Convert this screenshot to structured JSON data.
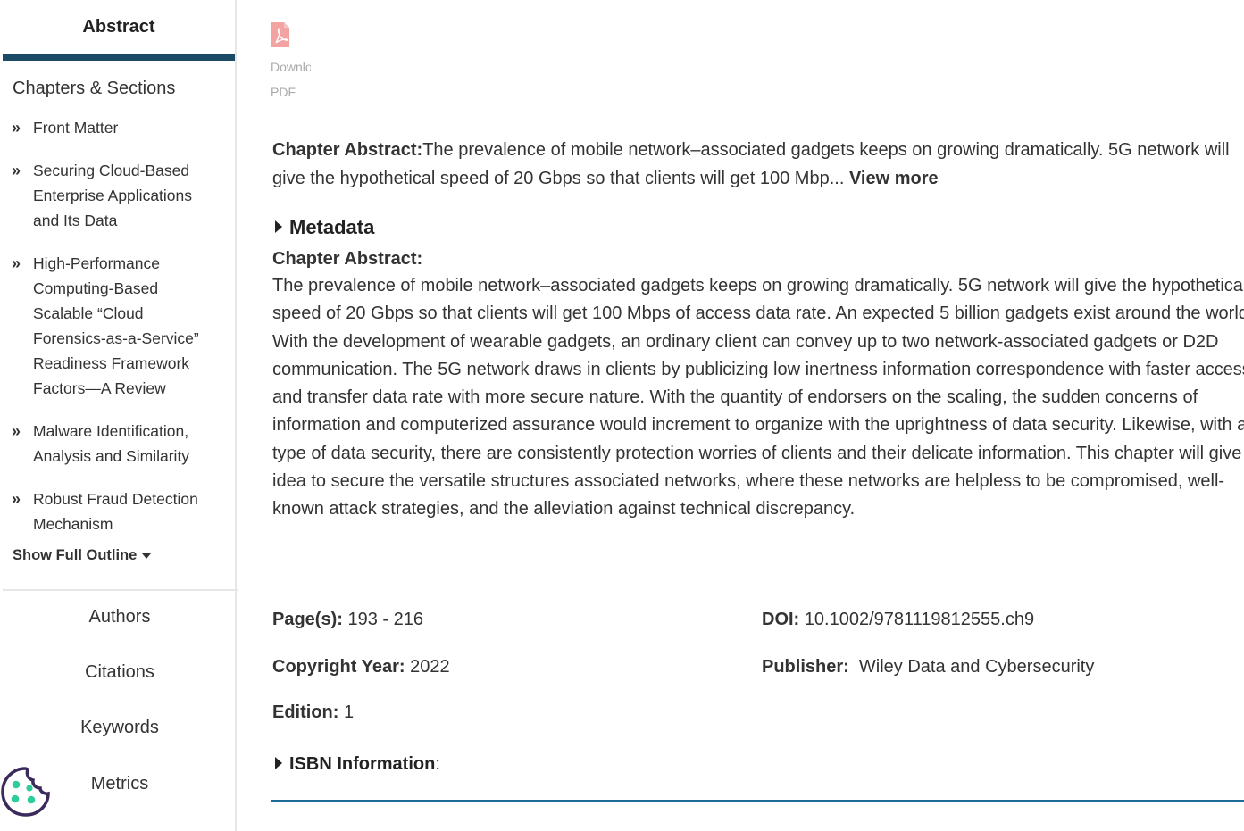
{
  "sidebar": {
    "abstract_tab": "Abstract",
    "toc_heading": "Chapters & Sections",
    "toc_items": [
      {
        "label": "Front Matter"
      },
      {
        "label": "Securing Cloud-Based Enterprise Applications and Its Data"
      },
      {
        "label": "High-Performance Computing-Based Scalable “Cloud Forensics-as-a-Service” Readiness Framework Factors—A Review"
      },
      {
        "label": "Malware Identification, Analysis and Similarity"
      },
      {
        "label": "Robust Fraud Detection Mechanism"
      }
    ],
    "show_outline": "Show Full Outline",
    "links": {
      "authors": "Authors",
      "citations": "Citations",
      "keywords": "Keywords",
      "metrics": "Metrics"
    }
  },
  "pdf": {
    "download_label": "Download",
    "pdf_label": "PDF"
  },
  "abstract": {
    "short_label": "Chapter Abstract:",
    "short_text": "The prevalence of mobile network–associated gadgets keeps on growing dramatically. 5G network will give the hypothetical speed of 20 Gbps so that clients will get 100 Mbp...",
    "view_more": "View more",
    "metadata_label": "Metadata",
    "full_label": "Chapter Abstract:",
    "full_text": "The prevalence of mobile network–associated gadgets keeps on growing dramatically. 5G network will give the hypothetical speed of 20 Gbps so that clients will get 100 Mbps of access data rate. An expected 5 billion gadgets exist around the world. With the development of wearable gadgets, an ordinary client can convey up to two network-associated gadgets or D2D communication. The 5G network draws in clients by publicizing low inertness information correspondence with faster access and transfer data rate with more secure nature. With the quantity of endorsers on the scaling, the sudden concerns of information and computerized assurance would increment to organize with the uprightness of data security. Likewise, with any type of data security, there are consistently protection worries of clients and their delicate information. This chapter will give an idea to secure the versatile structures associated networks, where these networks are helpless to be compromised, well-known attack strategies, and the alleviation against technical discrepancy."
  },
  "details": {
    "pages_label": "Page(s):",
    "pages_value": "193 - 216",
    "doi_label": "DOI:",
    "doi_value": "10.1002/9781119812555.ch9",
    "copyright_label": "Copyright Year:",
    "copyright_value": "2022",
    "publisher_label": "Publisher:",
    "publisher_value": "Wiley Data and Cybersecurity",
    "edition_label": "Edition:",
    "edition_value": "1",
    "isbn_label": "ISBN Information",
    "isbn_colon": ":"
  },
  "colors": {
    "tab_underline": "#1b4a66",
    "bottom_rule": "#1b6b96",
    "pdf_icon": "#f4a3a3",
    "cookie_outline": "#3b2a5c",
    "cookie_dots": "#2ecc9a"
  }
}
